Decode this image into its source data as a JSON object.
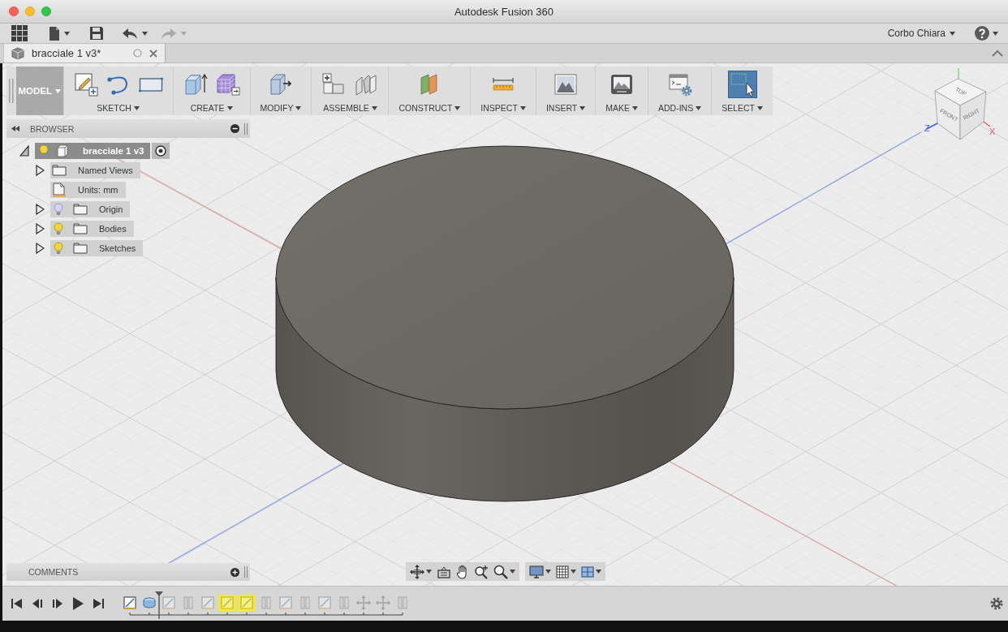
{
  "window": {
    "title": "Autodesk Fusion 360"
  },
  "quick_access": {
    "undo": {
      "disabled": false
    },
    "redo": {
      "disabled": true
    },
    "user": "Corbo Chiara"
  },
  "document_tab": {
    "title": "bracciale 1 v3*"
  },
  "ribbon": {
    "workspace": "MODEL",
    "groups": [
      {
        "kind": "sketch",
        "label": "SKETCH"
      },
      {
        "kind": "create",
        "label": "CREATE"
      },
      {
        "kind": "modify",
        "label": "MODIFY"
      },
      {
        "kind": "assemble",
        "label": "ASSEMBLE"
      },
      {
        "kind": "construct",
        "label": "CONSTRUCT"
      },
      {
        "kind": "inspect",
        "label": "INSPECT"
      },
      {
        "kind": "insert",
        "label": "INSERT"
      },
      {
        "kind": "make",
        "label": "MAKE"
      },
      {
        "kind": "addins",
        "label": "ADD-INS"
      },
      {
        "kind": "select",
        "label": "SELECT"
      }
    ]
  },
  "browser": {
    "title": "BROWSER",
    "tree": [
      {
        "kind": "component",
        "label": "bracciale 1 v3",
        "selected": true,
        "expanded": true,
        "visible": true,
        "children": [
          {
            "kind": "views",
            "label": "Named Views",
            "selected": false,
            "expanded": false
          },
          {
            "kind": "units",
            "label": "Units: mm",
            "selected": false
          },
          {
            "kind": "folder",
            "label": "Origin",
            "selected": false,
            "expanded": false,
            "visible": false
          },
          {
            "kind": "folder",
            "label": "Bodies",
            "selected": false,
            "expanded": false,
            "visible": true
          },
          {
            "kind": "folder",
            "label": "Sketches",
            "selected": false,
            "expanded": false,
            "visible": true
          }
        ]
      }
    ]
  },
  "view_cube": {
    "faces": [
      {
        "kind": "top",
        "label": "TOP"
      },
      {
        "kind": "front",
        "label": "FRONT"
      },
      {
        "kind": "right",
        "label": "RIGHT"
      }
    ],
    "axes": [
      {
        "kind": "z",
        "label": "Z"
      },
      {
        "kind": "x",
        "label": "X"
      }
    ]
  },
  "comments": {
    "title": "COMMENTS"
  },
  "timeline": {
    "items": [
      {
        "kind": "sketch",
        "rolled_back": false,
        "highlighted": false
      },
      {
        "kind": "extrude",
        "rolled_back": false,
        "highlighted": false
      },
      {
        "kind": "sketch",
        "rolled_back": true,
        "highlighted": false
      },
      {
        "kind": "feature",
        "rolled_back": true,
        "highlighted": false
      },
      {
        "kind": "sketch",
        "rolled_back": true,
        "highlighted": false
      },
      {
        "kind": "sketch",
        "rolled_back": true,
        "highlighted": true
      },
      {
        "kind": "sketch",
        "rolled_back": true,
        "highlighted": true
      },
      {
        "kind": "feature",
        "rolled_back": true,
        "highlighted": false
      },
      {
        "kind": "sketch",
        "rolled_back": true,
        "highlighted": false
      },
      {
        "kind": "feature",
        "rolled_back": true,
        "highlighted": false
      },
      {
        "kind": "sketch",
        "rolled_back": true,
        "highlighted": false
      },
      {
        "kind": "feature",
        "rolled_back": true,
        "highlighted": false
      },
      {
        "kind": "move",
        "rolled_back": true,
        "highlighted": false
      },
      {
        "kind": "move",
        "rolled_back": true,
        "highlighted": false
      },
      {
        "kind": "feature",
        "rolled_back": true,
        "highlighted": false
      }
    ]
  }
}
